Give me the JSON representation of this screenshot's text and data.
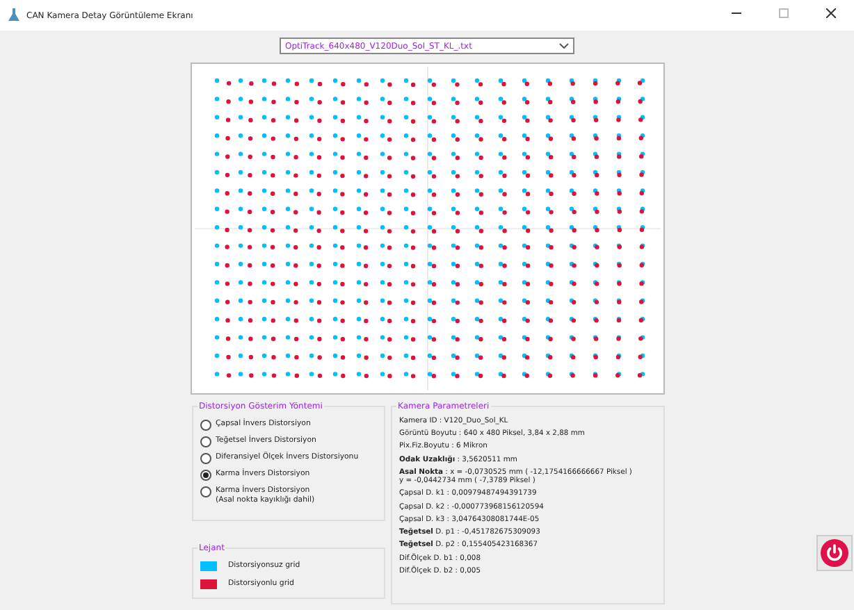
{
  "window": {
    "title": "CAN Kamera Detay Görüntüleme Ekranı"
  },
  "file_select": {
    "value": "OptiTrack_640x480_V120Duo_Sol_ST_KL_.txt"
  },
  "distortion_method": {
    "title": "Distorsiyon Gösterim Yöntemi",
    "options": [
      {
        "label": "Çapsal İnvers Distorsiyon",
        "selected": false
      },
      {
        "label": "Teğetsel İnvers Distorsiyon",
        "selected": false
      },
      {
        "label": "Diferansiyel Ölçek İnvers Distorsiyonu",
        "selected": false
      },
      {
        "label": "Karma İnvers Distorsiyon",
        "selected": true
      },
      {
        "label": "Karma İnvers Distorsiyon\n(Asal nokta kayıklığı dahil)",
        "selected": false
      }
    ]
  },
  "legend": {
    "title": "Lejant",
    "items": [
      {
        "label": "Distorsiyonsuz grid",
        "color": "#00bfff"
      },
      {
        "label": "Distorsiyonlu grid",
        "color": "#dc143c"
      }
    ]
  },
  "camera_parameters": {
    "title": "Kamera Parametreleri",
    "lines": [
      "Kamera ID : V120_Duo_Sol_KL",
      "Görüntü Boyutu : 640 x 480 Piksel, 3,84 x 2,88 mm",
      "Pix.Fiz.Boyutu : 6 Mikron",
      "**Odak Uzaklığı** : 3,5620511 mm",
      "**Asal Nokta** : x = -0,0730525 mm ( -12,1754166666667 Piksel )\ny = -0,0442734 mm ( -7,3789 Piksel )",
      "Çapsal D. k1 : 0,00979487494391739",
      "Çapsal D. k2 : -0,000773968156120594",
      "Çapsal D. k3 : 3,04764308081744E-05",
      "**Teğetsel** D. p1 : -0,451782675309093",
      "**Teğetsel** D. p2 : 0,155405423168367",
      "Dif.Ölçek D. b1 : 0,008",
      "Dif.Ölçek D. b2 : 0,005"
    ]
  }
}
